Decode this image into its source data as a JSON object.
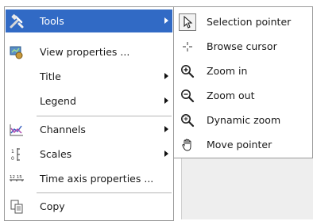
{
  "menu": {
    "items": [
      {
        "label": "Tools",
        "icon": "tools-icon",
        "has_submenu": true,
        "highlighted": true
      },
      {
        "label": "View properties ...",
        "icon": "view-properties-icon",
        "has_submenu": false
      },
      {
        "label": "Title",
        "icon": "",
        "has_submenu": true
      },
      {
        "label": "Legend",
        "icon": "",
        "has_submenu": true
      },
      {
        "label": "Channels",
        "icon": "channels-icon",
        "has_submenu": true
      },
      {
        "label": "Scales",
        "icon": "scales-icon",
        "has_submenu": true
      },
      {
        "label": "Time axis properties ...",
        "icon": "time-axis-icon",
        "has_submenu": false
      },
      {
        "label": "Copy",
        "icon": "copy-icon",
        "has_submenu": false
      }
    ]
  },
  "submenu": {
    "items": [
      {
        "label": "Selection pointer",
        "icon": "selection-pointer-icon",
        "selected": true
      },
      {
        "label": "Browse cursor",
        "icon": "browse-cursor-icon"
      },
      {
        "label": "Zoom in",
        "icon": "zoom-in-icon"
      },
      {
        "label": "Zoom out",
        "icon": "zoom-out-icon"
      },
      {
        "label": "Dynamic zoom",
        "icon": "dynamic-zoom-icon"
      },
      {
        "label": "Move pointer",
        "icon": "move-pointer-icon"
      }
    ]
  },
  "colors": {
    "highlight": "#316ac5",
    "highlight_text": "#ffffff",
    "menu_border": "#9a9a9a",
    "separator": "#b5b5b5"
  },
  "icons": {
    "time_axis_text": "12 15"
  }
}
